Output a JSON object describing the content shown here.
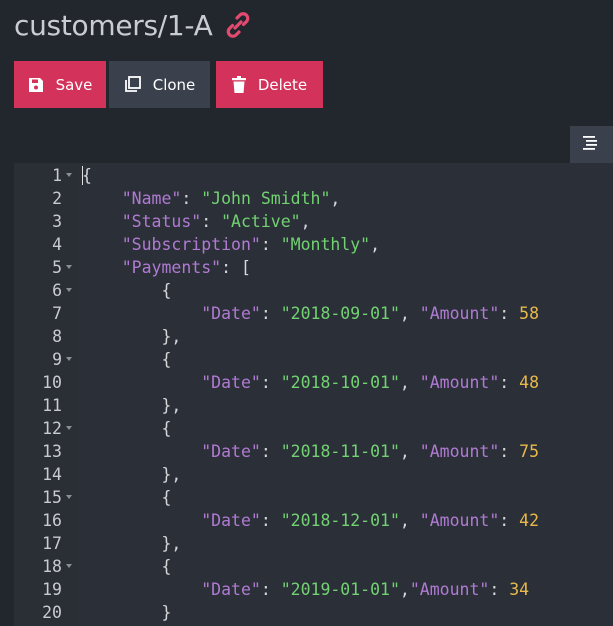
{
  "header": {
    "title": "customers/1-A",
    "link_icon": "link-icon",
    "accent": "#e24a70"
  },
  "toolbar": {
    "save": "Save",
    "clone": "Clone",
    "delete": "Delete"
  },
  "format_button": {
    "icon": "format-icon"
  },
  "editor": {
    "lines": [
      {
        "n": "1",
        "fold": true,
        "tokens": [
          [
            "p",
            "{"
          ]
        ]
      },
      {
        "n": "2",
        "fold": false,
        "tokens": [
          [
            "p",
            "    "
          ],
          [
            "k",
            "\"Name\""
          ],
          [
            "p",
            ": "
          ],
          [
            "s",
            "\"John Smidth\""
          ],
          [
            "p",
            ","
          ]
        ]
      },
      {
        "n": "3",
        "fold": false,
        "tokens": [
          [
            "p",
            "    "
          ],
          [
            "k",
            "\"Status\""
          ],
          [
            "p",
            ": "
          ],
          [
            "s",
            "\"Active\""
          ],
          [
            "p",
            ","
          ]
        ]
      },
      {
        "n": "4",
        "fold": false,
        "tokens": [
          [
            "p",
            "    "
          ],
          [
            "k",
            "\"Subscription\""
          ],
          [
            "p",
            ": "
          ],
          [
            "s",
            "\"Monthly\""
          ],
          [
            "p",
            ","
          ]
        ]
      },
      {
        "n": "5",
        "fold": true,
        "tokens": [
          [
            "p",
            "    "
          ],
          [
            "k",
            "\"Payments\""
          ],
          [
            "p",
            ": ["
          ]
        ]
      },
      {
        "n": "6",
        "fold": true,
        "tokens": [
          [
            "p",
            "        {"
          ]
        ]
      },
      {
        "n": "7",
        "fold": false,
        "tokens": [
          [
            "p",
            "            "
          ],
          [
            "k",
            "\"Date\""
          ],
          [
            "p",
            ": "
          ],
          [
            "s",
            "\"2018-09-01\""
          ],
          [
            "p",
            ", "
          ],
          [
            "k",
            "\"Amount\""
          ],
          [
            "p",
            ": "
          ],
          [
            "n",
            "58"
          ]
        ]
      },
      {
        "n": "8",
        "fold": false,
        "tokens": [
          [
            "p",
            "        },"
          ]
        ]
      },
      {
        "n": "9",
        "fold": true,
        "tokens": [
          [
            "p",
            "        {"
          ]
        ]
      },
      {
        "n": "10",
        "fold": false,
        "tokens": [
          [
            "p",
            "            "
          ],
          [
            "k",
            "\"Date\""
          ],
          [
            "p",
            ": "
          ],
          [
            "s",
            "\"2018-10-01\""
          ],
          [
            "p",
            ", "
          ],
          [
            "k",
            "\"Amount\""
          ],
          [
            "p",
            ": "
          ],
          [
            "n",
            "48"
          ]
        ]
      },
      {
        "n": "11",
        "fold": false,
        "tokens": [
          [
            "p",
            "        },"
          ]
        ]
      },
      {
        "n": "12",
        "fold": true,
        "tokens": [
          [
            "p",
            "        {"
          ]
        ]
      },
      {
        "n": "13",
        "fold": false,
        "tokens": [
          [
            "p",
            "            "
          ],
          [
            "k",
            "\"Date\""
          ],
          [
            "p",
            ": "
          ],
          [
            "s",
            "\"2018-11-01\""
          ],
          [
            "p",
            ", "
          ],
          [
            "k",
            "\"Amount\""
          ],
          [
            "p",
            ": "
          ],
          [
            "n",
            "75"
          ]
        ]
      },
      {
        "n": "14",
        "fold": false,
        "tokens": [
          [
            "p",
            "        },"
          ]
        ]
      },
      {
        "n": "15",
        "fold": true,
        "tokens": [
          [
            "p",
            "        {"
          ]
        ]
      },
      {
        "n": "16",
        "fold": false,
        "tokens": [
          [
            "p",
            "            "
          ],
          [
            "k",
            "\"Date\""
          ],
          [
            "p",
            ": "
          ],
          [
            "s",
            "\"2018-12-01\""
          ],
          [
            "p",
            ", "
          ],
          [
            "k",
            "\"Amount\""
          ],
          [
            "p",
            ": "
          ],
          [
            "n",
            "42"
          ]
        ]
      },
      {
        "n": "17",
        "fold": false,
        "tokens": [
          [
            "p",
            "        },"
          ]
        ]
      },
      {
        "n": "18",
        "fold": true,
        "tokens": [
          [
            "p",
            "        {"
          ]
        ]
      },
      {
        "n": "19",
        "fold": false,
        "tokens": [
          [
            "p",
            "            "
          ],
          [
            "k",
            "\"Date\""
          ],
          [
            "p",
            ": "
          ],
          [
            "s",
            "\"2019-01-01\""
          ],
          [
            "p",
            ","
          ],
          [
            "k",
            "\"Amount\""
          ],
          [
            "p",
            ": "
          ],
          [
            "n",
            "34"
          ]
        ]
      },
      {
        "n": "20",
        "fold": false,
        "tokens": [
          [
            "p",
            "        }"
          ]
        ]
      }
    ]
  }
}
